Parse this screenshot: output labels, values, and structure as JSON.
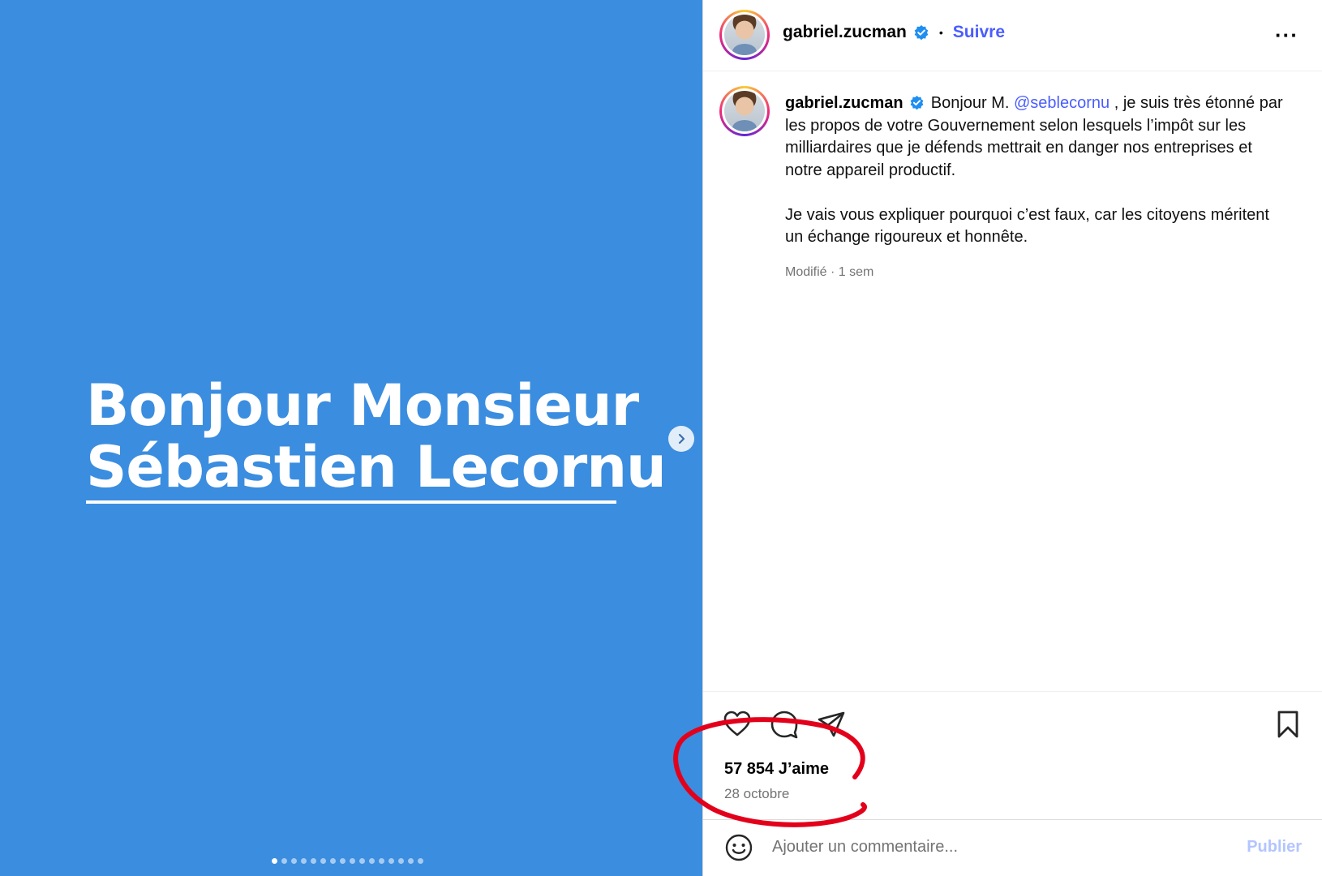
{
  "slide": {
    "line1": "Bonjour Monsieur",
    "line2": "Sébastien Lecornu",
    "background": "#3b8ddf",
    "dot_count": 16,
    "active_dot": 0
  },
  "header": {
    "username": "gabriel.zucman",
    "separator": "•",
    "follow_label": "Suivre",
    "more_label": "···"
  },
  "caption": {
    "username": "gabriel.zucman",
    "intro": "Bonjour M. ",
    "mention": "@seblecornu",
    "paragraph1_rest": " , je suis très étonné par les propos de votre Gouvernement selon lesquels l’impôt sur les milliardaires que je défends mettrait en danger nos entreprises et notre appareil productif.",
    "paragraph2": "Je vais vous expliquer pourquoi c’est faux, car les citoyens méritent un échange rigoureux et honnête.",
    "meta": "Modifié · 1 sem"
  },
  "actions": {
    "likes": "57 854 J’aime",
    "date": "28 octobre"
  },
  "comment": {
    "placeholder": "Ajouter un commentaire...",
    "publish_label": "Publier"
  },
  "colors": {
    "accent": "#4a5dff",
    "verified": "#1f8ef1",
    "annotation": "#e3001b"
  }
}
